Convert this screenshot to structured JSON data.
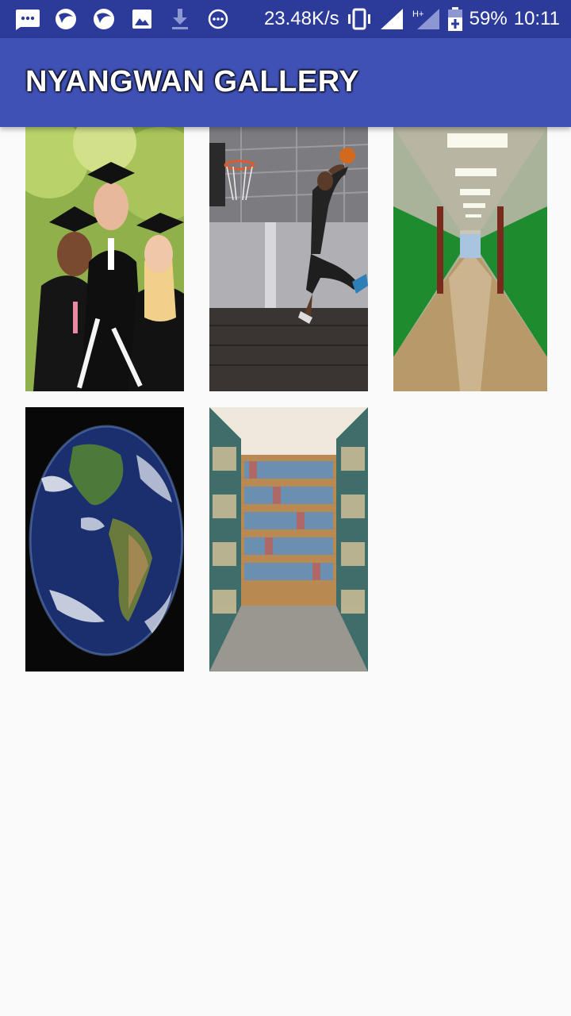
{
  "status_bar": {
    "net_speed": "23.48K/s",
    "battery": "59%",
    "time": "10:11"
  },
  "app_bar": {
    "title": "NYANGWAN GALLERY"
  },
  "gallery": {
    "items": [
      {
        "name": "graduates",
        "icon": "graduates-photo"
      },
      {
        "name": "basketball",
        "icon": "basketball-photo"
      },
      {
        "name": "hallway",
        "icon": "hallway-photo"
      },
      {
        "name": "earth",
        "icon": "earth-photo"
      },
      {
        "name": "library",
        "icon": "library-photo"
      }
    ]
  },
  "colors": {
    "status_bar": "#2c3a9a",
    "app_bar": "#3f51b5",
    "background": "#fafafa"
  }
}
